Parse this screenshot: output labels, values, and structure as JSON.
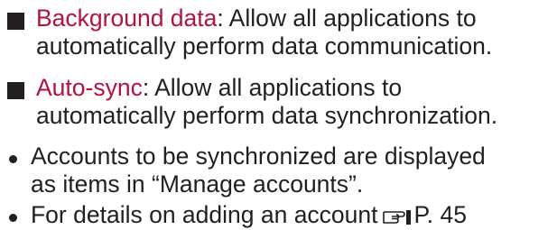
{
  "items": [
    {
      "marker": "square",
      "term": "Background data",
      "line1_rest": ": Allow all applications to",
      "line2": "automatically perform data communication."
    },
    {
      "marker": "square",
      "term": "Auto-sync",
      "line1_rest": ": Allow all applications to",
      "line2": "automatically perform data synchronization."
    },
    {
      "marker": "bullet",
      "line1": "Accounts to be synchronized are displayed",
      "line2": "as items in “Manage accounts”."
    },
    {
      "marker": "bullet",
      "text": "For details on adding an account",
      "ref_icon": "pointing-hand-icon",
      "page_ref": "P. 45"
    }
  ],
  "colors": {
    "term": "#b5123e",
    "text": "#231f20"
  }
}
